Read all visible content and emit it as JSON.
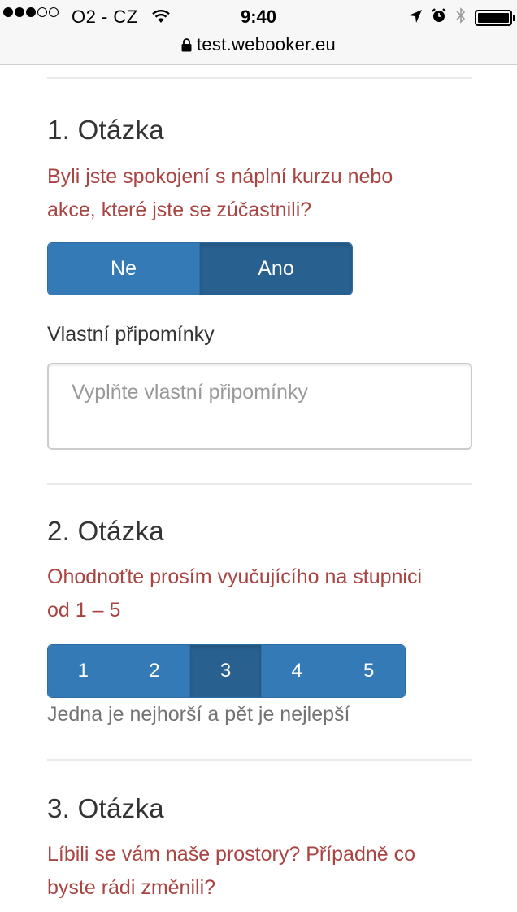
{
  "status_bar": {
    "carrier": "O2 - CZ",
    "time": "9:40",
    "signal_bars_filled": 3,
    "signal_bars_total": 5
  },
  "address_bar": {
    "url": "test.webooker.eu"
  },
  "questions": [
    {
      "title": "1. Otázka",
      "text_line1": "Byli jste spokojení s náplní kurzu nebo",
      "text_line2": "akce, které jste se zúčastnili?",
      "options": [
        "Ne",
        "Ano"
      ],
      "selected": "Ano",
      "comments_label": "Vlastní připomínky",
      "comments_placeholder": "Vyplňte vlastní připomínky"
    },
    {
      "title": "2. Otázka",
      "text_line1": "Ohodnoťte prosím vyučujícího na stupnici",
      "text_line2": "od 1 – 5",
      "options": [
        "1",
        "2",
        "3",
        "4",
        "5"
      ],
      "selected": "3",
      "help": "Jedna je nejhorší a pět je nejlepší"
    },
    {
      "title": "3. Otázka",
      "text_line1": "Líbili se vám naše prostory? Případně co",
      "text_line2": "byste rádi změnili?"
    }
  ],
  "colors": {
    "question_text": "#a94442",
    "button": "#337ab7",
    "button_active": "#286090"
  }
}
